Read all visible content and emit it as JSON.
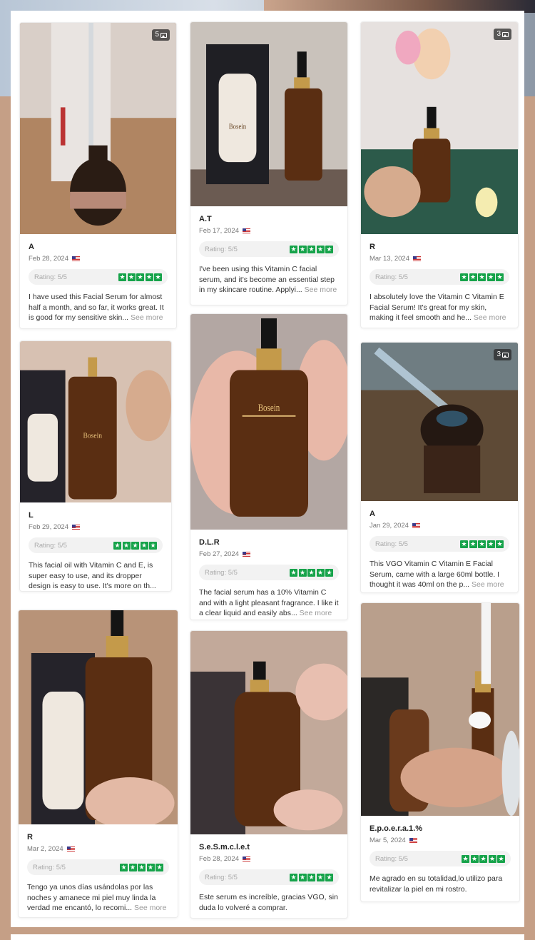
{
  "colors": {
    "star": "#16a34a",
    "page_bg": "#c59f86"
  },
  "rating_label": "Rating: 5/5",
  "see_more": "See more",
  "reviews": [
    {
      "name": "A",
      "date": "Feb 28, 2024",
      "photo_count": "5",
      "text": "I have used this Facial Serum for almost half a month, and so far, it works great. It is good for my sensitive skin...",
      "has_more": true,
      "stars": 5
    },
    {
      "name": "A.T",
      "date": "Feb 17, 2024",
      "photo_count": "",
      "text": "I've been using this Vitamin C facial serum, and it's become an essential step in my skincare routine. Applyi...",
      "has_more": true,
      "stars": 5
    },
    {
      "name": "R",
      "date": "Mar 13, 2024",
      "photo_count": "3",
      "text": "I absolutely love the Vitamin C Vitamin E Facial Serum! It's great for my skin, making it feel smooth and he...",
      "has_more": true,
      "stars": 5
    },
    {
      "name": "L",
      "date": "Feb 29, 2024",
      "photo_count": "",
      "text": "This facial oil with Vitamin C and E, is super easy to use, and its dropper design is easy to use. It's more on th...",
      "has_more": true,
      "stars": 5
    },
    {
      "name": "D.L.R",
      "date": "Feb 27, 2024",
      "photo_count": "",
      "text": "The facial serum has a 10% Vitamin C and with a light pleasant fragrance. I like it a clear liquid and easily abs...",
      "has_more": true,
      "stars": 5
    },
    {
      "name": "A",
      "date": "Jan 29, 2024",
      "photo_count": "3",
      "text": "This VGO Vitamin C Vitamin E Facial Serum, came with a large 60ml bottle. I thought it was 40ml on the p...",
      "has_more": true,
      "stars": 5
    },
    {
      "name": "R",
      "date": "Mar 2, 2024",
      "photo_count": "",
      "text": "Tengo ya unos días usándolas por las noches y amanece mi piel muy linda la verdad me encantó, lo recomi...",
      "has_more": true,
      "stars": 5
    },
    {
      "name": "S.e.S.m.c.l.e.t",
      "date": "Feb 28, 2024",
      "photo_count": "",
      "text": "Este serum es increíble, gracias VGO, sin duda lo volveré a comprar.",
      "has_more": false,
      "stars": 5
    },
    {
      "name": "E.p.o.e.r.a.1.%",
      "date": "Mar 5, 2024",
      "photo_count": "",
      "text": "Me agrado en su totalidad,lo utilizo para revitalizar la piel en mi rostro.",
      "has_more": false,
      "stars": 5
    }
  ]
}
